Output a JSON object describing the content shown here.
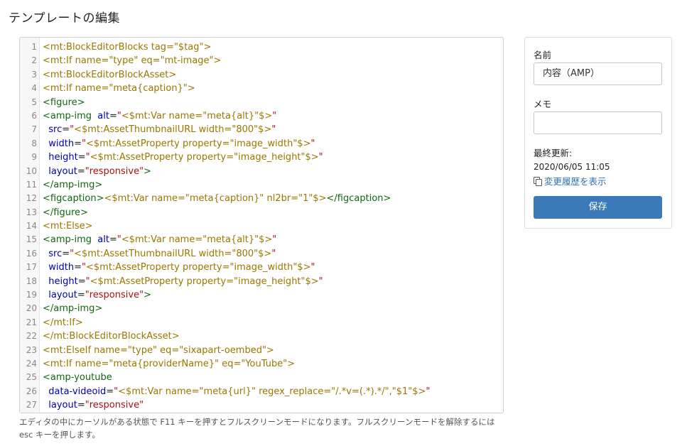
{
  "page": {
    "title": "テンプレートの編集"
  },
  "editor": {
    "lines": [
      {
        "n": "1",
        "segs": [
          [
            "mt",
            "<mt:BlockEditorBlocks tag=\"$tag\">"
          ]
        ]
      },
      {
        "n": "2",
        "segs": [
          [
            "mt",
            "<mt:If name=\"type\" eq=\"mt-image\">"
          ]
        ]
      },
      {
        "n": "3",
        "segs": [
          [
            "mt",
            "<mt:BlockEditorBlockAsset>"
          ]
        ]
      },
      {
        "n": "4",
        "segs": [
          [
            "mt",
            "<mt:If name=\"meta{caption}\">"
          ]
        ]
      },
      {
        "n": "5",
        "segs": [
          [
            "tag",
            "<figure>"
          ]
        ]
      },
      {
        "n": "6",
        "segs": [
          [
            "tag",
            "<amp-img "
          ],
          [
            "attr",
            " alt"
          ],
          [
            "plain",
            "="
          ],
          [
            "str",
            "\""
          ],
          [
            "mt",
            "<$mt:Var name=\"meta{alt}\"$>"
          ],
          [
            "str",
            "\""
          ]
        ]
      },
      {
        "n": "7",
        "segs": [
          [
            "attr",
            "  src"
          ],
          [
            "plain",
            "="
          ],
          [
            "str",
            "\""
          ],
          [
            "mt",
            "<$mt:AssetThumbnailURL width=\"800\"$>"
          ],
          [
            "str",
            "\""
          ]
        ]
      },
      {
        "n": "8",
        "segs": [
          [
            "attr",
            "  width"
          ],
          [
            "plain",
            "="
          ],
          [
            "str",
            "\""
          ],
          [
            "mt",
            "<$mt:AssetProperty property=\"image_width\"$>"
          ],
          [
            "str",
            "\""
          ]
        ]
      },
      {
        "n": "9",
        "segs": [
          [
            "attr",
            "  height"
          ],
          [
            "plain",
            "="
          ],
          [
            "str",
            "\""
          ],
          [
            "mt",
            "<$mt:AssetProperty property=\"image_height\"$>"
          ],
          [
            "str",
            "\""
          ]
        ]
      },
      {
        "n": "10",
        "segs": [
          [
            "attr",
            "  layout"
          ],
          [
            "plain",
            "="
          ],
          [
            "str",
            "\"responsive\""
          ],
          [
            "tag",
            ">"
          ]
        ]
      },
      {
        "n": "11",
        "segs": [
          [
            "tag",
            "</amp-img>"
          ]
        ]
      },
      {
        "n": "12",
        "segs": [
          [
            "tag",
            "<figcaption>"
          ],
          [
            "mt",
            "<$mt:Var name=\"meta{caption}\" nl2br=\"1\"$>"
          ],
          [
            "tag",
            "</figcaption>"
          ]
        ]
      },
      {
        "n": "13",
        "segs": [
          [
            "tag",
            "</figure>"
          ]
        ]
      },
      {
        "n": "14",
        "segs": [
          [
            "mt",
            "<mt:Else>"
          ]
        ]
      },
      {
        "n": "15",
        "segs": [
          [
            "tag",
            "<amp-img "
          ],
          [
            "attr",
            " alt"
          ],
          [
            "plain",
            "="
          ],
          [
            "str",
            "\""
          ],
          [
            "mt",
            "<$mt:Var name=\"meta{alt}\"$>"
          ],
          [
            "str",
            "\""
          ]
        ]
      },
      {
        "n": "16",
        "segs": [
          [
            "attr",
            "  src"
          ],
          [
            "plain",
            "="
          ],
          [
            "str",
            "\""
          ],
          [
            "mt",
            "<$mt:AssetThumbnailURL width=\"800\"$>"
          ],
          [
            "str",
            "\""
          ]
        ]
      },
      {
        "n": "17",
        "segs": [
          [
            "attr",
            "  width"
          ],
          [
            "plain",
            "="
          ],
          [
            "str",
            "\""
          ],
          [
            "mt",
            "<$mt:AssetProperty property=\"image_width\"$>"
          ],
          [
            "str",
            "\""
          ]
        ]
      },
      {
        "n": "18",
        "segs": [
          [
            "attr",
            "  height"
          ],
          [
            "plain",
            "="
          ],
          [
            "str",
            "\""
          ],
          [
            "mt",
            "<$mt:AssetProperty property=\"image_height\"$>"
          ],
          [
            "str",
            "\""
          ]
        ]
      },
      {
        "n": "19",
        "segs": [
          [
            "attr",
            "  layout"
          ],
          [
            "plain",
            "="
          ],
          [
            "str",
            "\"responsive\""
          ],
          [
            "tag",
            ">"
          ]
        ]
      },
      {
        "n": "20",
        "segs": [
          [
            "tag",
            "</amp-img>"
          ]
        ]
      },
      {
        "n": "21",
        "segs": [
          [
            "mt",
            "</mt:If>"
          ]
        ]
      },
      {
        "n": "22",
        "segs": [
          [
            "mt",
            "</mt:BlockEditorBlockAsset>"
          ]
        ]
      },
      {
        "n": "23",
        "segs": [
          [
            "mt",
            "<mt:ElseIf name=\"type\" eq=\"sixapart-oembed\">"
          ]
        ]
      },
      {
        "n": "24",
        "segs": [
          [
            "mt",
            "<mt:If name=\"meta{providerName}\" eq=\"YouTube\">"
          ]
        ]
      },
      {
        "n": "25",
        "segs": [
          [
            "tag",
            "<amp-youtube"
          ]
        ]
      },
      {
        "n": "26",
        "segs": [
          [
            "attr",
            "  data-videoid"
          ],
          [
            "plain",
            "="
          ],
          [
            "str",
            "\""
          ],
          [
            "mt",
            "<$mt:Var name=\"meta{url}\" regex_replace=\"/.*v=(.*).*/\",\"$1\"$>"
          ],
          [
            "str",
            "\""
          ]
        ]
      },
      {
        "n": "27",
        "segs": [
          [
            "attr",
            "  layout"
          ],
          [
            "plain",
            "="
          ],
          [
            "str",
            "\"responsive\""
          ]
        ]
      }
    ],
    "help_text": "エディタの中にカーソルがある状態で F11 キーを押すとフルスクリーンモードになります。フルスクリーンモードを解除するには esc キーを押します。"
  },
  "sidebar": {
    "name_label": "名前",
    "name_value": "内容（AMP）",
    "memo_label": "メモ",
    "memo_value": "",
    "updated_label": "最終更新:",
    "updated_value": "2020/06/05 11:05",
    "history_link": "変更履歴を表示",
    "save_button": "保存"
  },
  "colors": {
    "accent": "#3a7ab8",
    "link": "#2f6fb0",
    "code_tag": "#116611",
    "code_mt": "#997700",
    "code_attr": "#0000aa",
    "code_string": "#aa1111"
  }
}
